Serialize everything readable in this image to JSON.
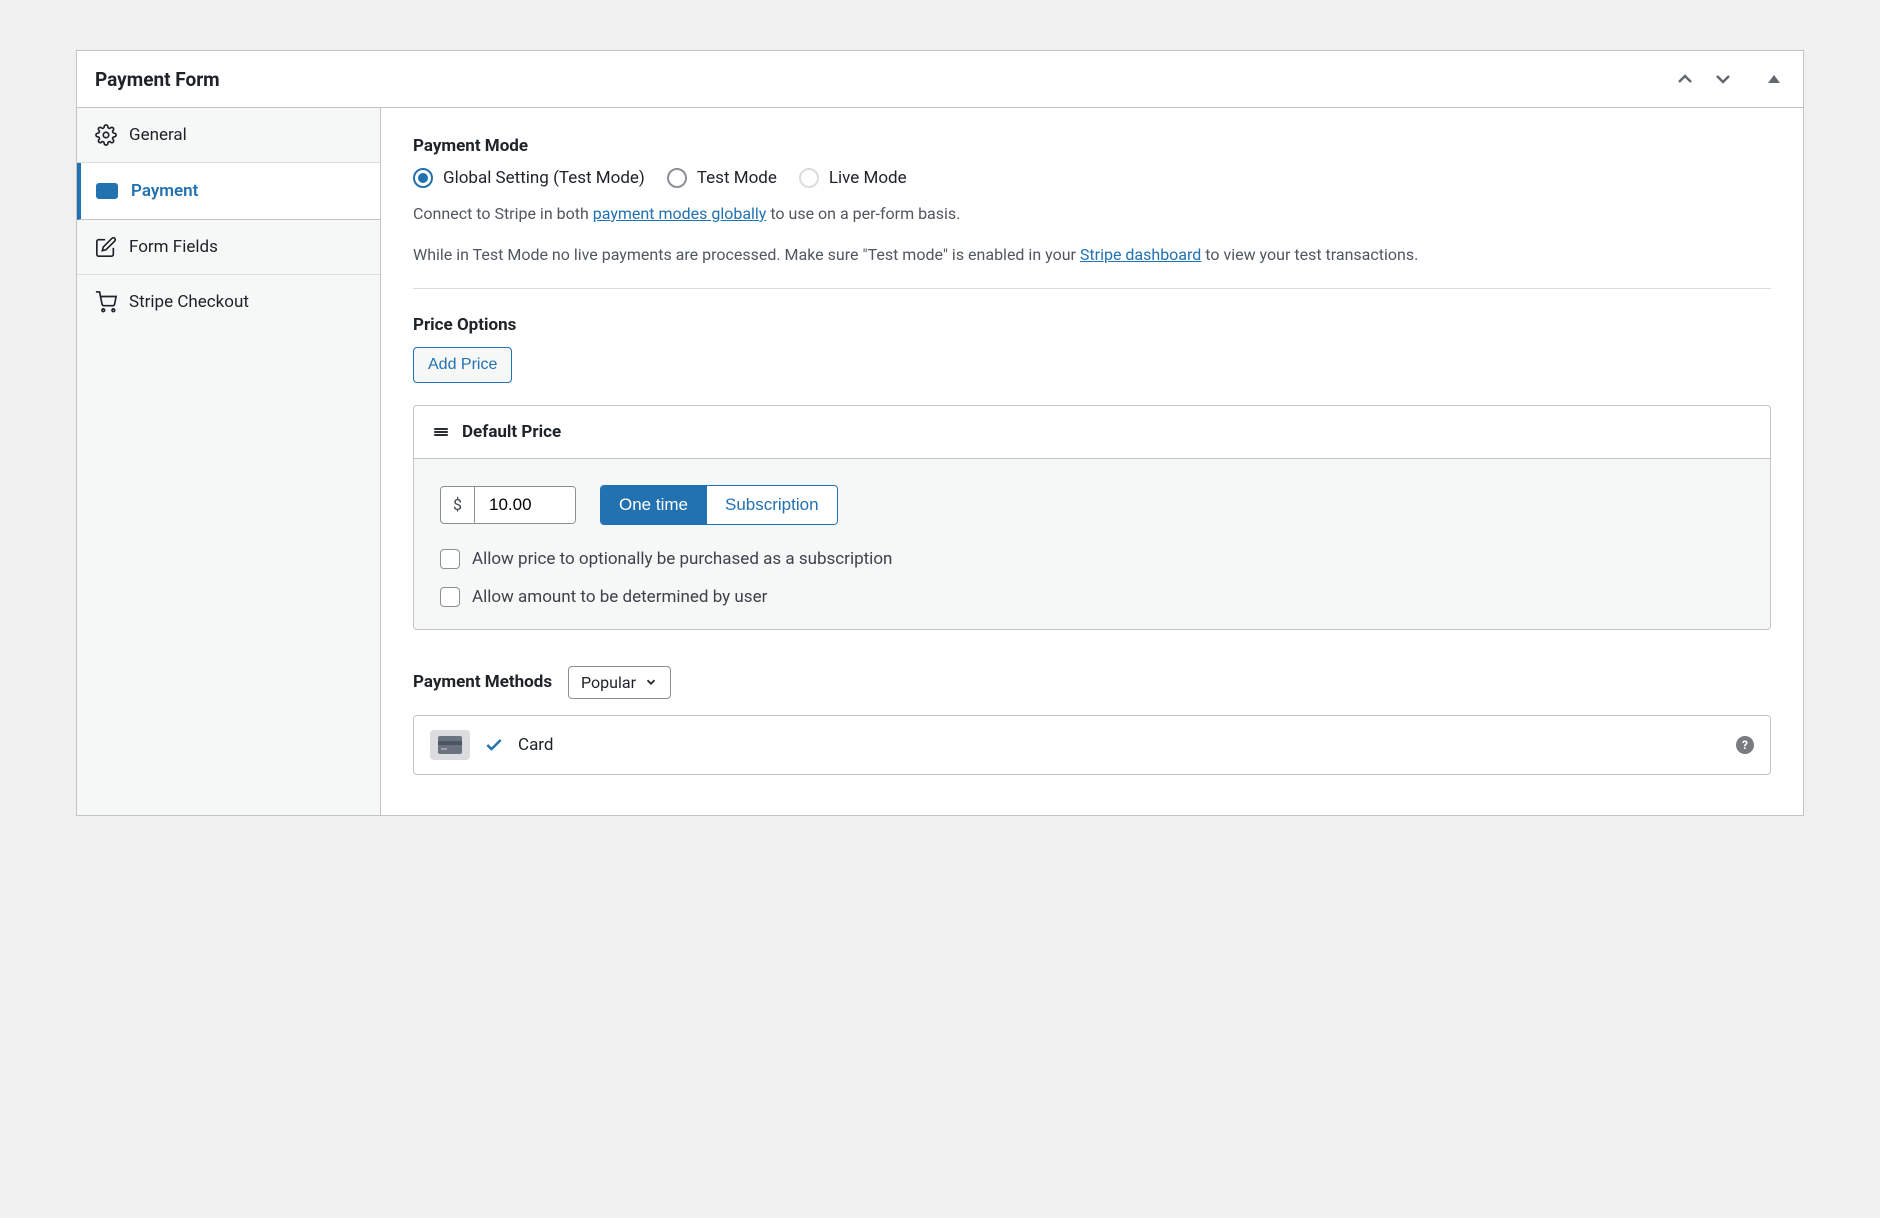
{
  "panel": {
    "title": "Payment Form"
  },
  "sidebar": {
    "items": [
      {
        "label": "General"
      },
      {
        "label": "Payment"
      },
      {
        "label": "Form Fields"
      },
      {
        "label": "Stripe Checkout"
      }
    ]
  },
  "payment_mode": {
    "heading": "Payment Mode",
    "options": {
      "global": "Global Setting (Test Mode)",
      "test": "Test Mode",
      "live": "Live Mode"
    },
    "help_prefix": "Connect to Stripe in both ",
    "help_link1": "payment modes globally",
    "help_suffix": " to use on a per-form basis.",
    "note_prefix": "While in Test Mode no live payments are processed. Make sure \"Test mode\" is enabled in your ",
    "note_link": "Stripe dashboard",
    "note_suffix": " to view your test transactions."
  },
  "price_options": {
    "heading": "Price Options",
    "add_button": "Add Price",
    "card_title": "Default Price",
    "currency": "$",
    "amount": "10.00",
    "toggle": {
      "one_time": "One time",
      "subscription": "Subscription"
    },
    "checkbox1": "Allow price to optionally be purchased as a subscription",
    "checkbox2": "Allow amount to be determined by user"
  },
  "payment_methods": {
    "heading": "Payment Methods",
    "filter": "Popular",
    "card_label": "Card"
  }
}
